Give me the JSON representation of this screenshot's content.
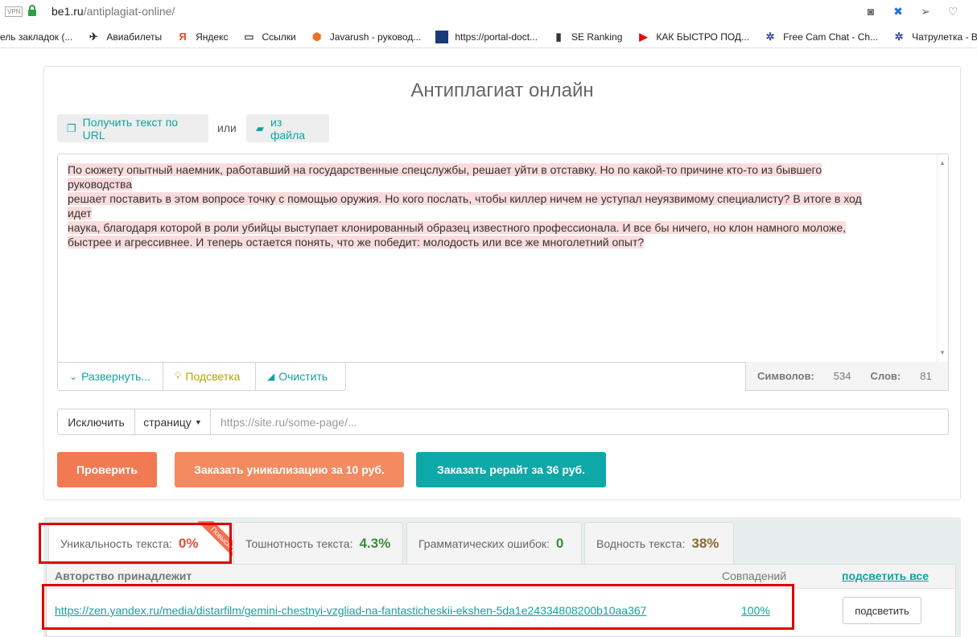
{
  "browser": {
    "vpn": "VPN",
    "url_host": "be1.ru",
    "url_path": "/antiplagiat-online/"
  },
  "bookmarks": [
    {
      "label": "ель закладок (...",
      "icon": "panel-icon"
    },
    {
      "label": "Авиабилеты",
      "icon": "plane-icon"
    },
    {
      "label": "Яндекс",
      "icon": "yandex-icon"
    },
    {
      "label": "Ссылки",
      "icon": "folder-icon"
    },
    {
      "label": "Javarush - руковод...",
      "icon": "javarush-icon"
    },
    {
      "label": "https://portal-doct...",
      "icon": "square-icon"
    },
    {
      "label": "SE Ranking",
      "icon": "bars-icon"
    },
    {
      "label": "КАК БЫСТРО ПОД...",
      "icon": "youtube-icon"
    },
    {
      "label": "Free Cam Chat - Ch...",
      "icon": "chat-icon"
    },
    {
      "label": "Чатрулетка - Виде...",
      "icon": "chat-icon"
    }
  ],
  "page": {
    "title": "Антиплагиат онлайн",
    "get_url_label": "Получить текст по URL",
    "or_label": "или",
    "from_file_label": "из файла",
    "text_segments": [
      "По сюжету опытный наемник, работавший на государственные спецслужбы, решает уйти в отставку. Но по какой-то причине кто-то из бывшего руководства",
      "решает поставить в этом вопросе точку с помощью оружия. Но кого послать, чтобы киллер ничем не уступал неуязвимому специалисту? В итоге в ход идет",
      "наука, благодаря которой в роли убийцы выступает клонированный образец известного профессионала. И все бы ничего, но клон намного моложе,",
      "быстрее и агрессивнее. И теперь остается понять, что же победит: молодость или все же многолетний опыт?"
    ],
    "tools": {
      "expand": "Развернуть...",
      "highlight": "Подсветка",
      "clear": "Очистить"
    },
    "counts": {
      "chars_label": "Символов:",
      "chars_value": "534",
      "words_label": "Слов:",
      "words_value": "81"
    },
    "exclude": {
      "label": "Исключить",
      "dropdown": "страницу",
      "placeholder": "https://site.ru/some-page/..."
    },
    "actions": {
      "check": "Проверить",
      "order_unique": "Заказать уникализацию за 10 руб.",
      "order_rewrite": "Заказать рерайт за 36 руб."
    },
    "colors": {
      "teal": "#0fa3a3",
      "orange": "#f27a53",
      "orange_light": "#f48a60",
      "red": "#e00000"
    }
  },
  "results": {
    "tabs": [
      {
        "label": "Уникальность текста:",
        "value": "0%",
        "ribbon": "Повысить",
        "color": "#e0503a"
      },
      {
        "label": "Тошнотность текста:",
        "value": "4.3%",
        "color": "#3c8c3c"
      },
      {
        "label": "Грамматических ошибок:",
        "value": "0",
        "color": "#3c8c3c"
      },
      {
        "label": "Водность текста:",
        "value": "38%",
        "color": "#8a6a2e"
      }
    ],
    "columns": {
      "author": "Авторство принадлежит",
      "matches": "Совпадений",
      "highlight_all": "подсветить все"
    },
    "rows": [
      {
        "url": "https://zen.yandex.ru/media/distarfilm/gemini-chestnyi-vzgliad-na-fantasticheskii-ekshen-5da1e24334808200b10aa367",
        "match": "100%",
        "button": "подсветить"
      }
    ]
  }
}
